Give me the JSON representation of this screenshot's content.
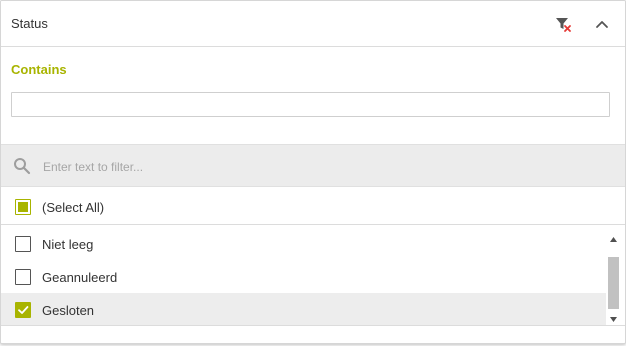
{
  "header": {
    "title": "Status",
    "clear_filter_icon": "filter-clear-icon",
    "collapse_icon": "chevron-up-icon"
  },
  "condition": {
    "label": "Contains",
    "value": ""
  },
  "search": {
    "placeholder": "Enter text to filter...",
    "icon": "search-icon"
  },
  "select_all": {
    "label": "(Select All)",
    "state": "indeterminate"
  },
  "items": [
    {
      "label": "Niet leeg",
      "checked": false,
      "selected": false
    },
    {
      "label": "Geannuleerd",
      "checked": false,
      "selected": false
    },
    {
      "label": "Gesloten",
      "checked": true,
      "selected": true
    }
  ],
  "colors": {
    "accent": "#a8b400",
    "clear_x": "#e53935",
    "selected_row": "#ededed",
    "search_bar": "#ececec"
  }
}
